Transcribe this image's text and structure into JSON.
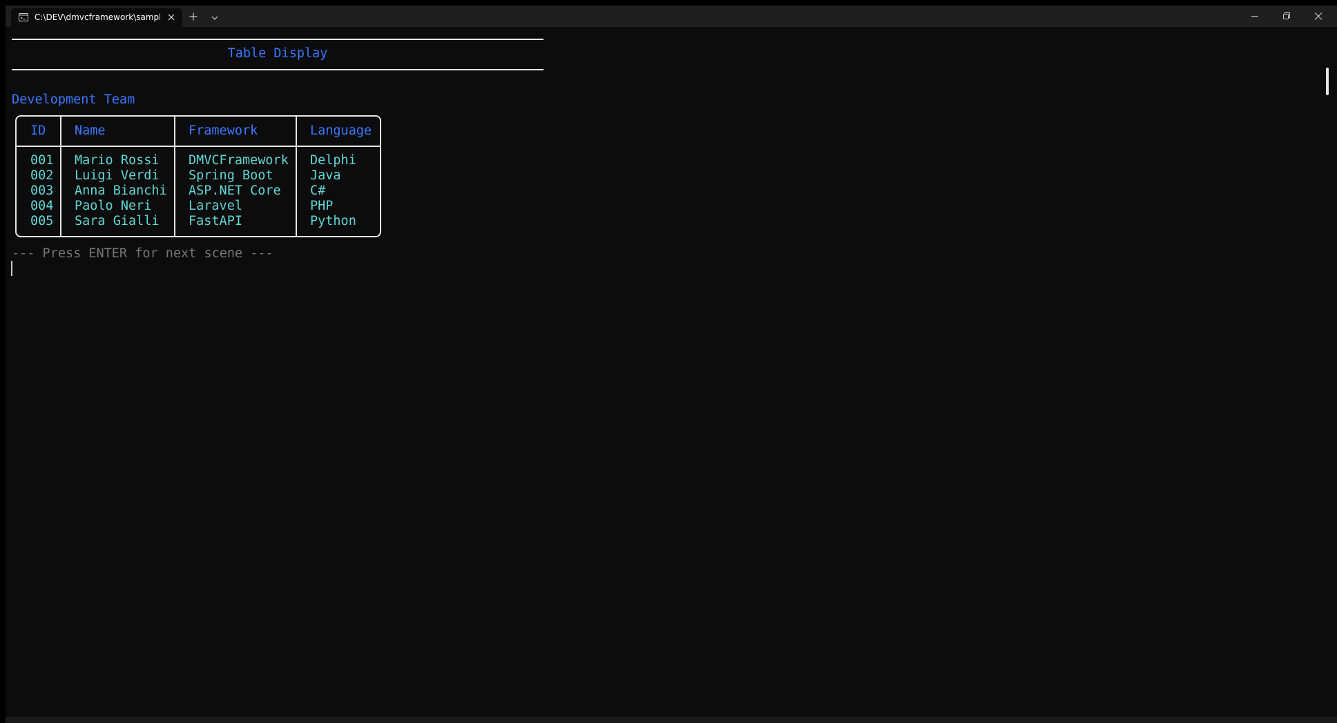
{
  "window": {
    "tab_title": "C:\\DEV\\dmvcframework\\samples",
    "tab_icon": "terminal-icon",
    "new_tab_icon": "plus-icon",
    "dropdown_icon": "chevron-down-icon",
    "controls": [
      "minimize-icon",
      "restore-icon",
      "close-icon"
    ]
  },
  "terminal": {
    "scene_title": "Table Display",
    "section_title": "Development Team",
    "table": {
      "headers": [
        "ID",
        "Name",
        "Framework",
        "Language"
      ],
      "rows": [
        [
          "001",
          "Mario Rossi",
          "DMVCFramework",
          "Delphi"
        ],
        [
          "002",
          "Luigi Verdi",
          "Spring Boot",
          "Java"
        ],
        [
          "003",
          "Anna Bianchi",
          "ASP.NET Core",
          "C#"
        ],
        [
          "004",
          "Paolo Neri",
          "Laravel",
          "PHP"
        ],
        [
          "005",
          "Sara Gialli",
          "FastAPI",
          "Python"
        ]
      ]
    },
    "prompt": "--- Press ENTER for next scene ---"
  },
  "colors": {
    "background": "#0c0c0c",
    "heading_blue": "#3b78ff",
    "cell_cyan": "#61d6d6",
    "prompt_gray": "#767676",
    "border_white": "#e8e8e8"
  }
}
